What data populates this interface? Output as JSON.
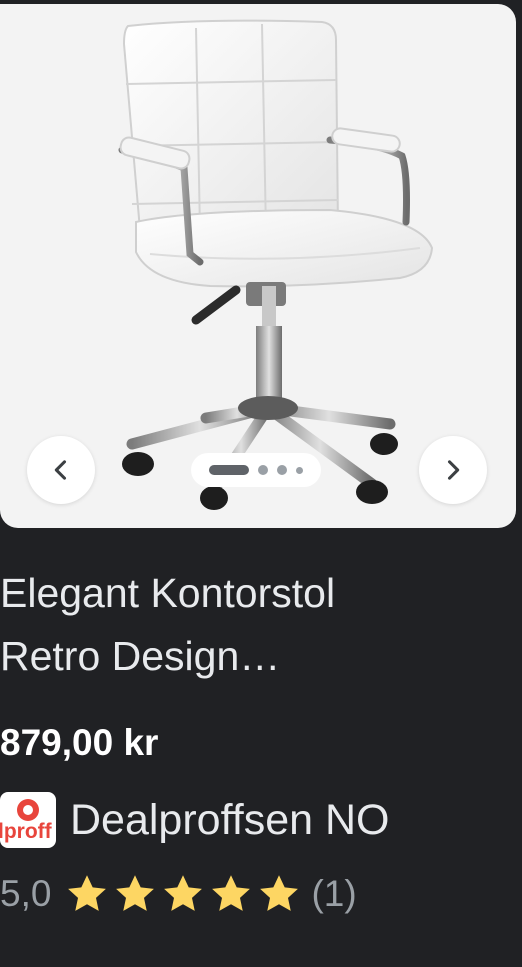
{
  "product": {
    "title_line1": "Elegant Kontorstol",
    "title_line2": "Retro Design…",
    "price": "879,00 kr",
    "image_alt": "Elegant Kontorstol Retro Design"
  },
  "carousel": {
    "prev_icon": "chevron-left-icon",
    "next_icon": "chevron-right-icon",
    "pages": 4,
    "active_page": 1
  },
  "seller": {
    "name": "Dealproffsen NO",
    "logo_text": "lproff",
    "logo_icon": "dealproffsen-logo-icon"
  },
  "rating": {
    "value": "5,0",
    "stars": 5,
    "max_stars": 5,
    "count": "(1)",
    "star_color": "#fdd663"
  },
  "colors": {
    "background": "#202124",
    "text": "#e8eaed",
    "muted": "#9aa0a6",
    "brand": "#e8453c"
  }
}
